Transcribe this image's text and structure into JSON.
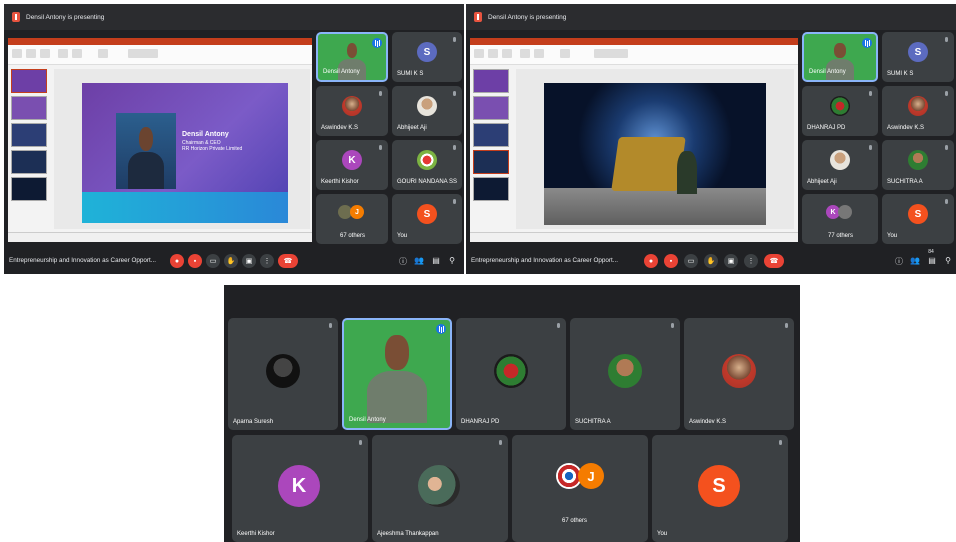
{
  "screen1": {
    "presenting": "Densil Antony is presenting",
    "slide": {
      "name": "Densil Antony",
      "title": "Chairman & CEO",
      "company": "RR Horizon Private Limited"
    },
    "tiles": [
      {
        "name": "Densil Antony",
        "type": "video"
      },
      {
        "name": "SUMI K S",
        "initial": "S",
        "color": "#5c6bc0"
      },
      {
        "name": "Aswindev K.S",
        "type": "photo"
      },
      {
        "name": "Abhijeet Aji",
        "type": "photo"
      },
      {
        "name": "Keerthi Kishor",
        "initial": "K",
        "color": "#ab47bc"
      },
      {
        "name": "GOURI NANDANA SS",
        "type": "photo"
      },
      {
        "name": "67 others",
        "initial": "J",
        "color": "#f57c00"
      },
      {
        "name": "You",
        "initial": "S",
        "color": "#f4511e"
      }
    ],
    "meeting_title": "Entrepreneurship and Innovation as Career Opport..."
  },
  "screen2": {
    "presenting": "Densil Antony is presenting",
    "tiles": [
      {
        "name": "Densil Antony",
        "type": "video"
      },
      {
        "name": "SUMI K S",
        "initial": "S",
        "color": "#5c6bc0"
      },
      {
        "name": "DHANRAJ PD",
        "type": "photo"
      },
      {
        "name": "Aswindev K.S",
        "type": "photo"
      },
      {
        "name": "Abhijeet Aji",
        "type": "photo"
      },
      {
        "name": "SUCHITRA A",
        "type": "photo"
      },
      {
        "name": "77 others",
        "initial": "K",
        "color": "#ab47bc"
      },
      {
        "name": "You",
        "initial": "S",
        "color": "#f4511e"
      }
    ],
    "meeting_title": "Entrepreneurship and Innovation as Career Opport..."
  },
  "screen3": {
    "tiles": [
      {
        "name": "Aparna Suresh",
        "type": "photo"
      },
      {
        "name": "Densil Antony",
        "type": "video"
      },
      {
        "name": "DHANRAJ PD",
        "type": "photo"
      },
      {
        "name": "SUCHITRA A",
        "type": "photo"
      },
      {
        "name": "Aswindev K.S",
        "type": "photo"
      },
      {
        "name": "Keerthi Kishor",
        "initial": "K",
        "color": "#ab47bc"
      },
      {
        "name": "Ajeeshma Thankappan",
        "type": "photo"
      },
      {
        "name": "67 others",
        "initial": "J",
        "color": "#f57c00"
      },
      {
        "name": "You",
        "initial": "S",
        "color": "#f4511e"
      }
    ]
  },
  "icons": {
    "mic_off": "mic-off-icon",
    "cam_off": "camera-off-icon",
    "captions": "captions-icon",
    "raise_hand": "raise-hand-icon",
    "present": "present-icon",
    "more": "more-options-icon",
    "hangup": "hang-up-icon",
    "info": "info-icon",
    "people": "people-icon",
    "chat": "chat-icon",
    "activities": "activities-icon"
  },
  "participant_badge": "84"
}
